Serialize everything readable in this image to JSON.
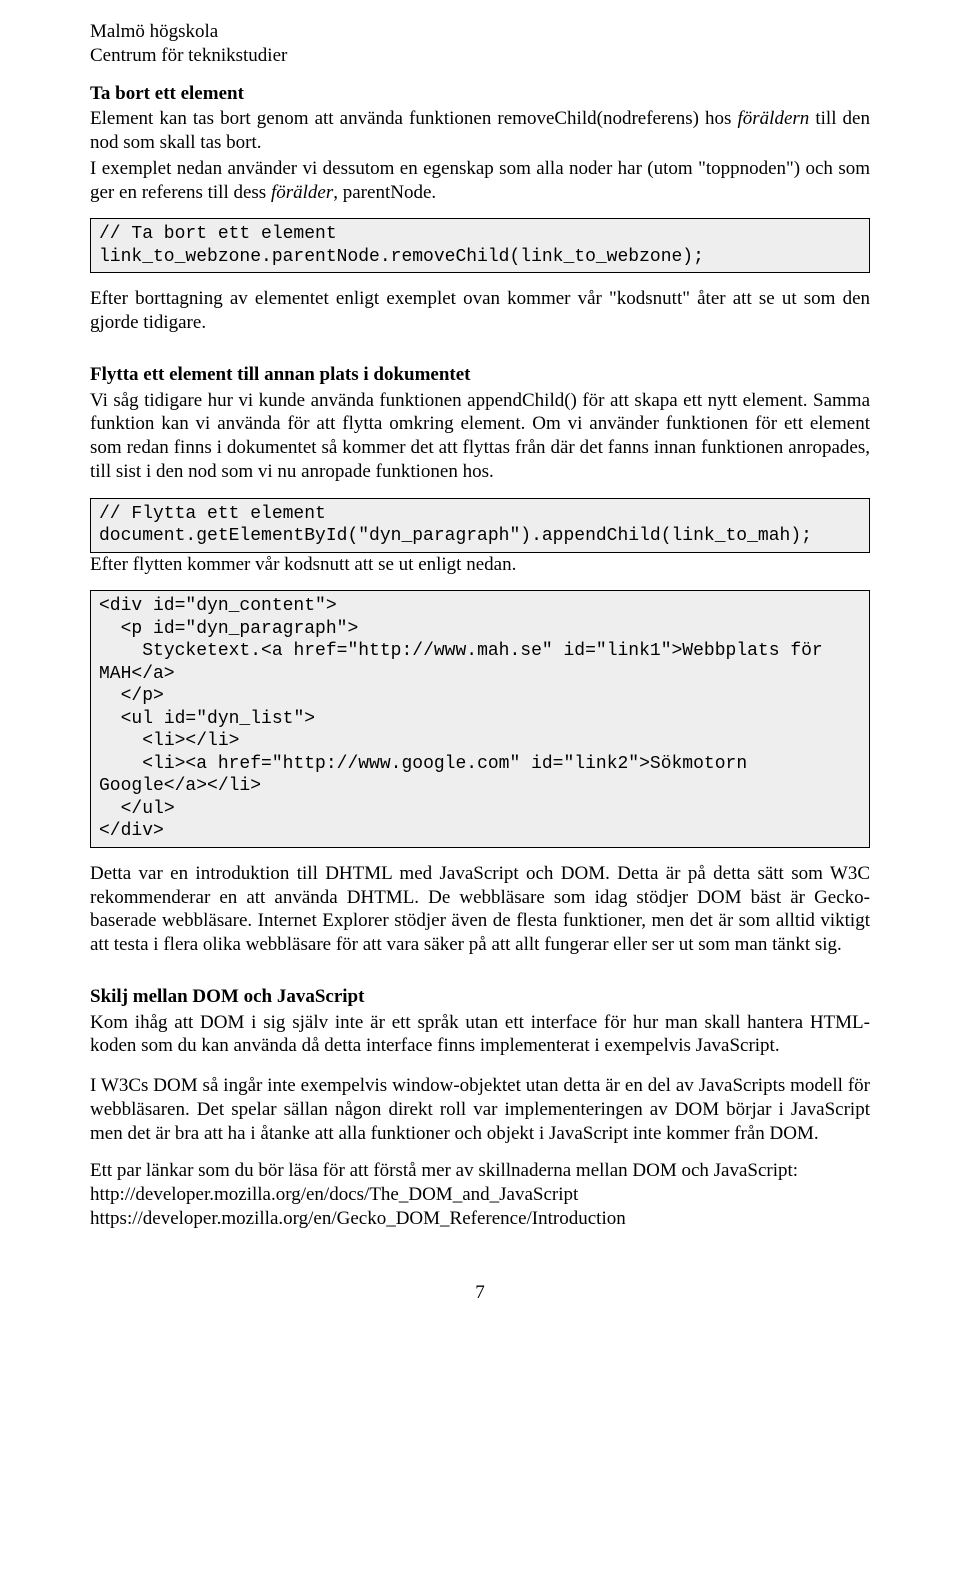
{
  "header": {
    "line1": "Malmö högskola",
    "line2": "Centrum för teknikstudier"
  },
  "sec1": {
    "heading": "Ta bort ett element",
    "para1_a": "Element kan tas bort genom att använda funktionen removeChild(nodreferens) hos ",
    "para1_i1": "föräldern",
    "para1_b": " till den nod som skall tas bort.",
    "para2_a": "I exemplet nedan använder vi dessutom en egenskap som alla noder har (utom \"toppnoden\") och som ger en referens till dess ",
    "para2_i1": "förälder",
    "para2_b": ", parentNode."
  },
  "code1": "// Ta bort ett element\nlink_to_webzone.parentNode.removeChild(link_to_webzone);",
  "after_code1": "Efter borttagning av elementet enligt exemplet ovan kommer vår \"kodsnutt\" åter att se ut som den gjorde tidigare.",
  "sec2": {
    "heading": "Flytta ett element till annan plats i dokumentet",
    "para": "Vi såg tidigare hur vi kunde använda funktionen appendChild() för att skapa ett nytt element. Samma funktion kan vi använda för att flytta omkring element. Om vi använder funktionen för ett element som redan finns i dokumentet så kommer det att flyttas från där det fanns innan funktionen anropades, till sist i den nod som vi nu anropade funktionen hos."
  },
  "code2": "// Flytta ett element\ndocument.getElementById(\"dyn_paragraph\").appendChild(link_to_mah);",
  "after_code2": "Efter flytten kommer vår kodsnutt att se ut enligt nedan.",
  "code3": "<div id=\"dyn_content\">\n  <p id=\"dyn_paragraph\">\n    Stycketext.<a href=\"http://www.mah.se\" id=\"link1\">Webbplats för\nMAH</a>\n  </p>\n  <ul id=\"dyn_list\">\n    <li></li>\n    <li><a href=\"http://www.google.com\" id=\"link2\">Sökmotorn\nGoogle</a></li>\n  </ul>\n</div>",
  "conclusion": "Detta var en introduktion till DHTML med JavaScript och DOM. Detta är på detta sätt som W3C rekommenderar en att använda DHTML. De webbläsare som idag stödjer DOM bäst är Gecko-baserade webbläsare. Internet Explorer stödjer även de flesta funktioner, men det är som alltid viktigt att testa i flera olika webbläsare för att vara säker på att allt fungerar eller ser ut som man tänkt sig.",
  "sec3": {
    "heading": "Skilj mellan DOM och JavaScript",
    "para1": "Kom ihåg att DOM i sig själv inte är ett språk utan ett interface för hur man skall hantera HTML-koden som du kan använda då detta interface finns implementerat i exempelvis JavaScript.",
    "para2": "I W3Cs DOM så ingår inte exempelvis window-objektet utan detta är en del av JavaScripts modell för webbläsaren. Det spelar sällan någon direkt roll var implementeringen av DOM börjar i JavaScript men det är bra att ha i åtanke att alla funktioner och objekt i JavaScript inte kommer från DOM.",
    "para3": "Ett par länkar som du bör läsa för att förstå mer av skillnaderna mellan DOM och JavaScript:",
    "link1": "http://developer.mozilla.org/en/docs/The_DOM_and_JavaScript",
    "link2": "https://developer.mozilla.org/en/Gecko_DOM_Reference/Introduction"
  },
  "page_number": "7"
}
